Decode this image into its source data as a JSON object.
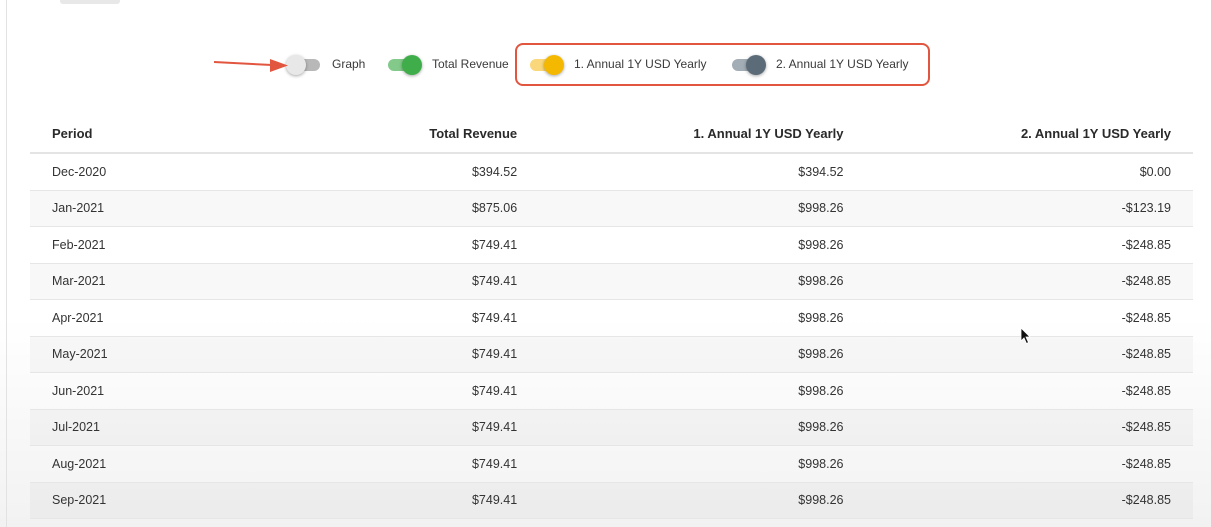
{
  "toggles": [
    {
      "label": "Graph",
      "state": "off",
      "track_color": "#b8b8b8",
      "thumb_color": "#e8e8e8"
    },
    {
      "label": "Total Revenue",
      "state": "on",
      "track_color": "#82c98a",
      "thumb_color": "#3fae4a"
    },
    {
      "label": "1. Annual 1Y USD Yearly",
      "state": "on",
      "track_color": "#f9d77a",
      "thumb_color": "#f5b800"
    },
    {
      "label": "2. Annual 1Y USD Yearly",
      "state": "on",
      "track_color": "#a2adb5",
      "thumb_color": "#5b6b77"
    }
  ],
  "annotation_color": "#e2553f",
  "table": {
    "headers": [
      "Period",
      "Total Revenue",
      "1. Annual 1Y USD Yearly",
      "2. Annual 1Y USD Yearly"
    ],
    "rows": [
      [
        "Dec-2020",
        "$394.52",
        "$394.52",
        "$0.00"
      ],
      [
        "Jan-2021",
        "$875.06",
        "$998.26",
        "-$123.19"
      ],
      [
        "Feb-2021",
        "$749.41",
        "$998.26",
        "-$248.85"
      ],
      [
        "Mar-2021",
        "$749.41",
        "$998.26",
        "-$248.85"
      ],
      [
        "Apr-2021",
        "$749.41",
        "$998.26",
        "-$248.85"
      ],
      [
        "May-2021",
        "$749.41",
        "$998.26",
        "-$248.85"
      ],
      [
        "Jun-2021",
        "$749.41",
        "$998.26",
        "-$248.85"
      ],
      [
        "Jul-2021",
        "$749.41",
        "$998.26",
        "-$248.85"
      ],
      [
        "Aug-2021",
        "$749.41",
        "$998.26",
        "-$248.85"
      ],
      [
        "Sep-2021",
        "$749.41",
        "$998.26",
        "-$248.85"
      ]
    ]
  }
}
